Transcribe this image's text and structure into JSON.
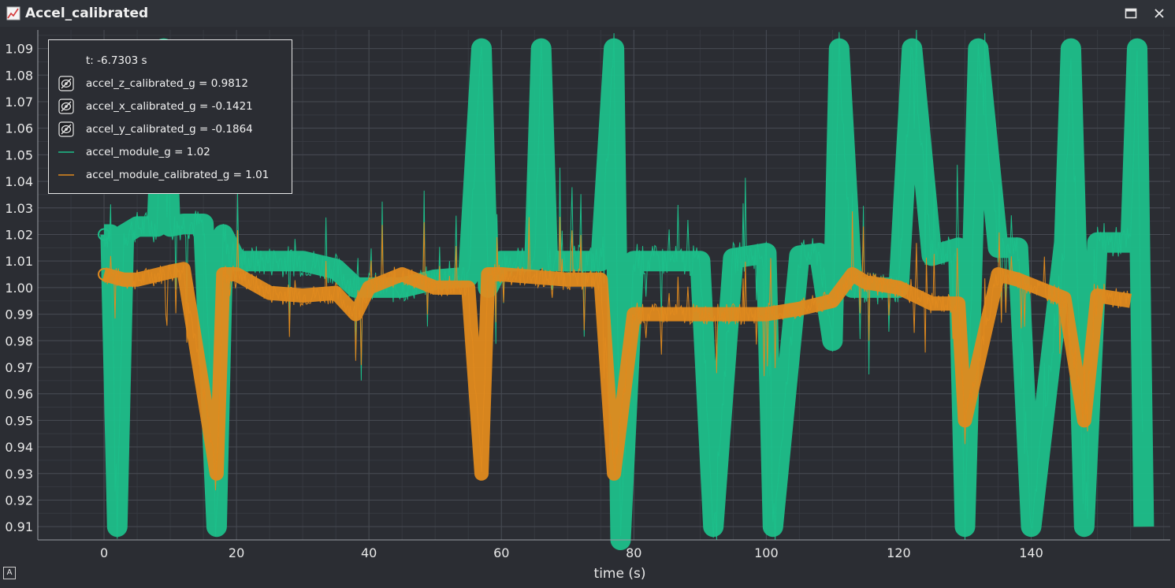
{
  "window": {
    "title": "Accel_calibrated",
    "icons": [
      "chart-icon",
      "maximize-icon",
      "close-icon"
    ]
  },
  "legend": {
    "cursor_text": "t: -6.7303 s",
    "items": [
      {
        "label": "accel_z_calibrated_g = 0.9812",
        "symbol": "hidden-eye-icon"
      },
      {
        "label": "accel_x_calibrated_g = -0.1421",
        "symbol": "hidden-eye-icon"
      },
      {
        "label": "accel_y_calibrated_g = -0.1864",
        "symbol": "hidden-eye-icon"
      },
      {
        "label": "accel_module_g = 1.02",
        "symbol": "line",
        "color": "#1dbf8a"
      },
      {
        "label": "accel_module_calibrated_g = 1.01",
        "symbol": "line",
        "color": "#e08a1e"
      }
    ]
  },
  "chart_data": {
    "type": "line",
    "xlabel": "time (s)",
    "ylabel": "",
    "xlim": [
      -10,
      161
    ],
    "ylim": [
      0.905,
      1.097
    ],
    "x_ticks": [
      0,
      20,
      40,
      60,
      80,
      100,
      120,
      140
    ],
    "y_ticks": [
      0.91,
      0.92,
      0.93,
      0.94,
      0.95,
      0.96,
      0.97,
      0.98,
      0.99,
      1.0,
      1.01,
      1.02,
      1.03,
      1.04,
      1.05,
      1.06,
      1.07,
      1.08,
      1.09
    ],
    "y_tick_labels": [
      "0.91",
      "0.92",
      "0.93",
      "0.94",
      "0.95",
      "0.96",
      "0.97",
      "0.98",
      "0.99",
      "1.00",
      "1.01",
      "1.02",
      "1.03",
      "1.04",
      "1.05",
      "1.06",
      "1.07",
      "1.08",
      "1.09"
    ],
    "grid": true,
    "colors": {
      "module": "#1dbf8a",
      "module_calibrated": "#e08a1e",
      "background": "#2b2d33",
      "grid": "#474a52"
    },
    "series": [
      {
        "name": "accel_module_g",
        "x": [
          0,
          1,
          2,
          3,
          5,
          8,
          9,
          10,
          12,
          15,
          17,
          18,
          20,
          25,
          30,
          35,
          38,
          40,
          45,
          50,
          55,
          57,
          58,
          60,
          65,
          66,
          67,
          70,
          75,
          77,
          78,
          80,
          85,
          90,
          92,
          95,
          100,
          101,
          105,
          108,
          110,
          111,
          113,
          115,
          120,
          122,
          125,
          129,
          130,
          132,
          135,
          138,
          140,
          145,
          146,
          148,
          150,
          155,
          156,
          157
        ],
        "y": [
          1.02,
          1.02,
          0.91,
          1.02,
          1.023,
          1.023,
          1.09,
          1.023,
          1.024,
          1.024,
          0.91,
          1.02,
          1.01,
          1.01,
          1.01,
          1.007,
          1.0,
          1.0,
          1.0,
          1.003,
          1.004,
          1.09,
          1.0,
          1.01,
          1.01,
          1.09,
          1.01,
          1.01,
          1.01,
          1.09,
          0.905,
          1.01,
          1.01,
          1.01,
          0.91,
          1.011,
          1.013,
          0.91,
          1.012,
          1.013,
          0.98,
          1.09,
          1.0,
          1.0,
          1.0,
          1.09,
          1.012,
          1.015,
          0.91,
          1.09,
          1.015,
          1.015,
          0.91,
          1.017,
          1.09,
          0.91,
          1.017,
          1.017,
          1.09,
          0.91
        ]
      },
      {
        "name": "accel_module_calibrated_g",
        "x": [
          0,
          3,
          5,
          10,
          12,
          17,
          18,
          20,
          25,
          30,
          35,
          38,
          40,
          45,
          50,
          55,
          57,
          58,
          60,
          65,
          70,
          75,
          77,
          80,
          85,
          90,
          95,
          100,
          105,
          110,
          113,
          115,
          120,
          125,
          129,
          130,
          135,
          138,
          145,
          148,
          150,
          155
        ],
        "y": [
          1.005,
          1.003,
          1.003,
          1.006,
          1.007,
          0.93,
          1.005,
          1.005,
          0.998,
          0.997,
          0.998,
          0.99,
          1.0,
          1.005,
          1.0,
          1.0,
          0.93,
          1.005,
          1.005,
          1.004,
          1.003,
          1.003,
          0.93,
          0.99,
          0.99,
          0.99,
          0.99,
          0.99,
          0.992,
          0.995,
          1.005,
          1.002,
          1.0,
          0.994,
          0.994,
          0.95,
          1.005,
          1.003,
          0.996,
          0.95,
          0.997,
          0.995
        ]
      }
    ]
  }
}
